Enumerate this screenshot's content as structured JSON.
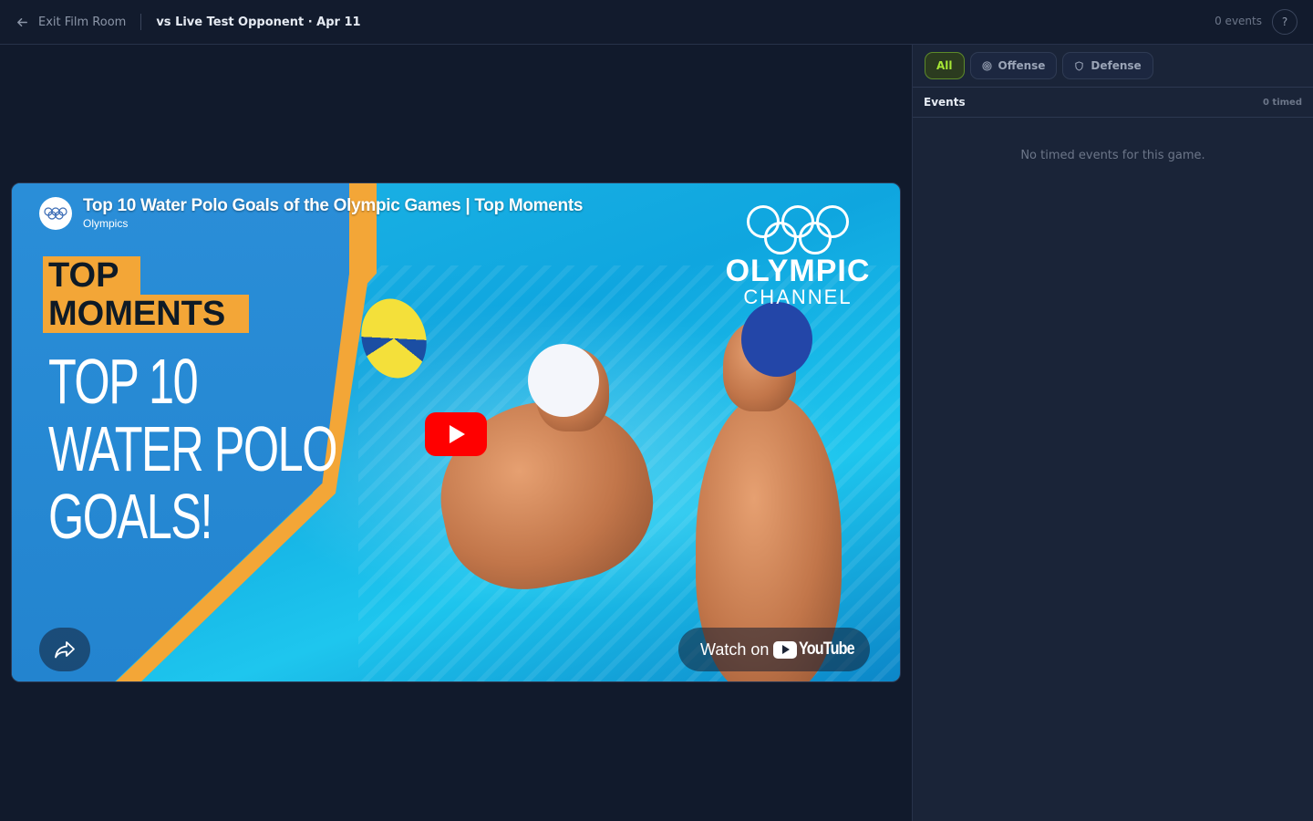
{
  "topbar": {
    "exit_label": "Exit Film Room",
    "game_title": "vs Live Test Opponent · Apr 11",
    "events_count": "0 events",
    "help_label": "?"
  },
  "video": {
    "title": "Top 10 Water Polo Goals of the Olympic Games | Top Moments",
    "channel": "Olympics",
    "thumb_top": "TOP",
    "thumb_moments": "MOMENTS",
    "thumb_line1": "TOP 10",
    "thumb_line2": "WATER POLO",
    "thumb_line3": "GOALS!",
    "logo_word1": "OLYMPIC",
    "logo_word2": "CHANNEL",
    "watch_on": "Watch on",
    "youtube_word": "YouTube"
  },
  "filters": [
    {
      "label": "All",
      "active": true
    },
    {
      "label": "Offense",
      "active": false
    },
    {
      "label": "Defense",
      "active": false
    }
  ],
  "events_panel": {
    "label": "Events",
    "timed_count": "0 timed",
    "empty_message": "No timed events for this game."
  },
  "colors": {
    "background": "#111a2c",
    "sidebar": "#1a2438",
    "active_accent": "#a6e635",
    "youtube_red": "#ff0000",
    "thumb_orange": "#f3a637"
  },
  "icons": {
    "exit": "arrow-left-icon",
    "offense": "target-icon",
    "defense": "shield-icon",
    "share": "share-arrow-icon",
    "play": "play-icon"
  }
}
